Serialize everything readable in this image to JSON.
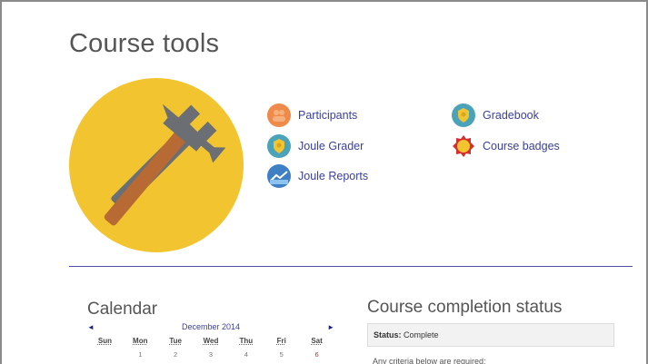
{
  "page": {
    "title": "Course tools"
  },
  "tools": [
    {
      "label": "Participants",
      "icon": "participants-icon",
      "color": "#f08a4b"
    },
    {
      "label": "Joule Grader",
      "icon": "joule-grader-icon",
      "color": "#4aa3b8"
    },
    {
      "label": "Joule Reports",
      "icon": "joule-reports-icon",
      "color": "#3f7fc4"
    },
    {
      "label": "Gradebook",
      "icon": "gradebook-icon",
      "color": "#4aa3b8"
    },
    {
      "label": "Course badges",
      "icon": "course-badges-icon",
      "color": "#d32f2f"
    }
  ],
  "hero": {
    "icon": "wrench-hammer-icon",
    "bg_color": "#f2c530"
  },
  "calendar": {
    "title": "Calendar",
    "month": "December 2014",
    "prev": "◄",
    "next": "►",
    "day_names": [
      "Sun",
      "Mon",
      "Tue",
      "Wed",
      "Thu",
      "Fri",
      "Sat"
    ],
    "first_row": [
      "",
      "1",
      "2",
      "3",
      "4",
      "5",
      "6"
    ]
  },
  "completion": {
    "title": "Course completion status",
    "status_label": "Status:",
    "status_value": "Complete",
    "criteria_text": "Any criteria below are required:"
  },
  "colors": {
    "link": "#3a3f9a",
    "divider": "#4b4fa0",
    "accent_red": "#c62828"
  }
}
